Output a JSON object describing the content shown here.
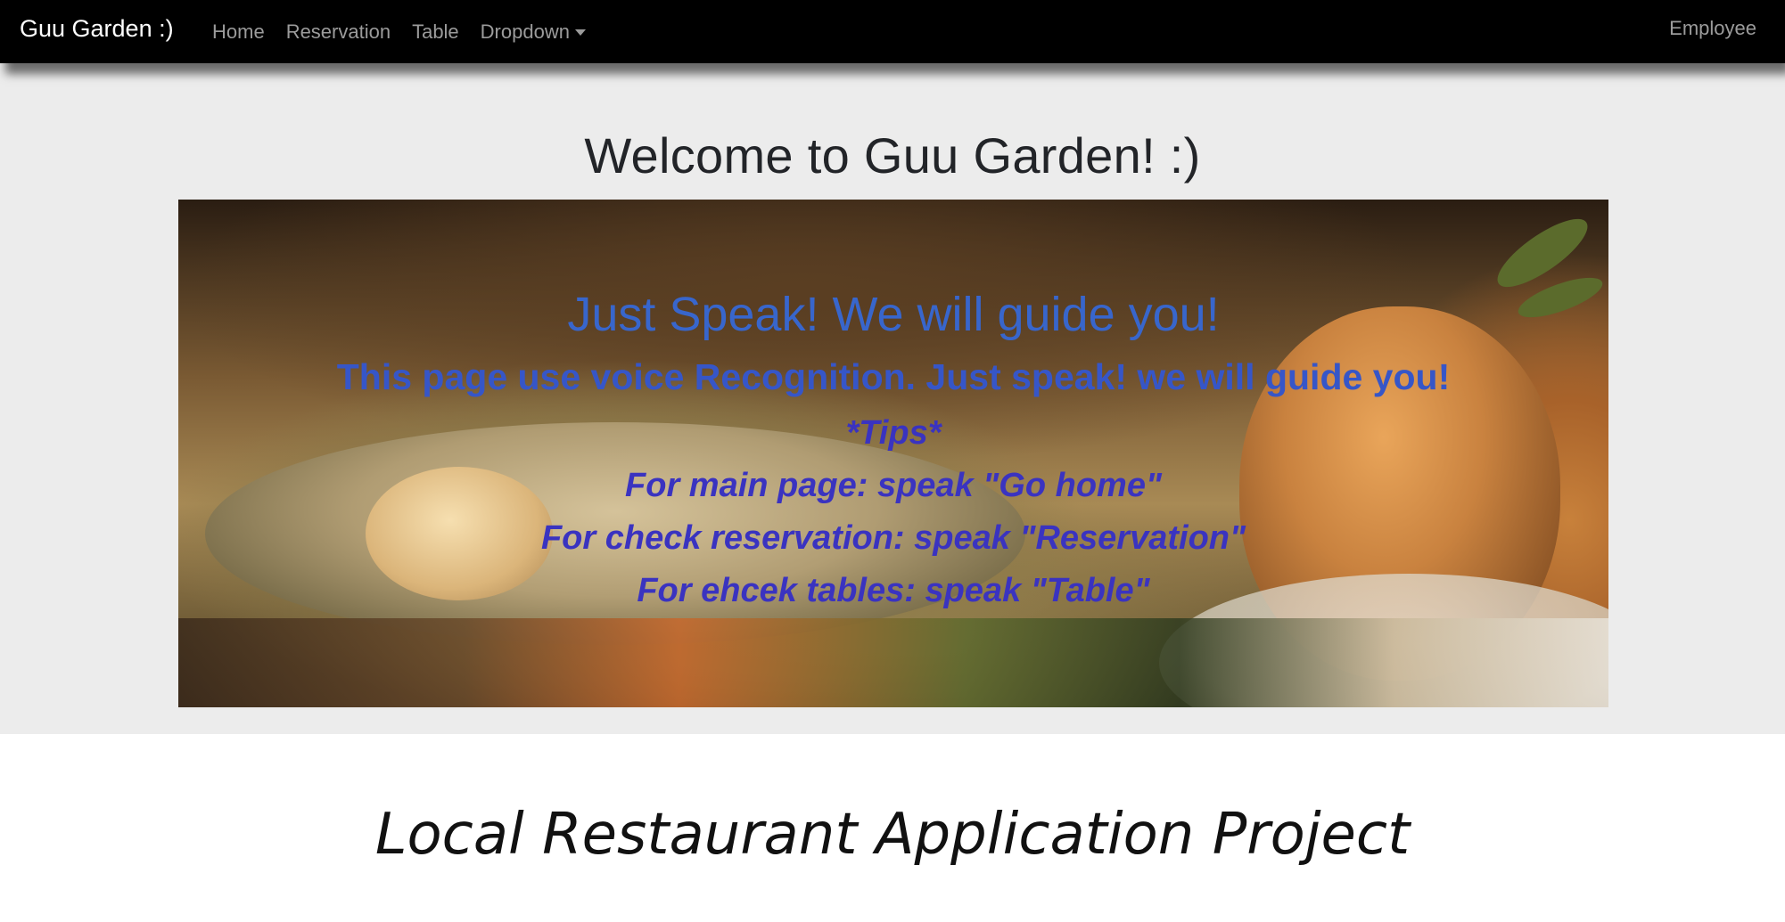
{
  "navbar": {
    "brand": "Guu Garden :)",
    "links": [
      "Home",
      "Reservation",
      "Table",
      "Dropdown"
    ],
    "right_link": "Employee"
  },
  "main": {
    "welcome_heading": "Welcome to Guu Garden! :)",
    "hero": {
      "title": "Just Speak! We will guide you!",
      "subtitle": "This page use voice Recognition. Just speak! we will guide you!",
      "tips_heading": "*Tips*",
      "tips": [
        "For main page: speak \"Go home\"",
        "For check reservation: speak \"Reservation\"",
        "For ehcek tables: speak \"Table\""
      ]
    }
  },
  "caption": "Local Restaurant Application Project",
  "colors": {
    "navbar_bg": "#000000",
    "nav_link": "#9b9b9b",
    "hero_text_blue": "#3866cc",
    "tips_text_indigo": "#3a33c0",
    "jumbotron_bg": "#ececec"
  }
}
